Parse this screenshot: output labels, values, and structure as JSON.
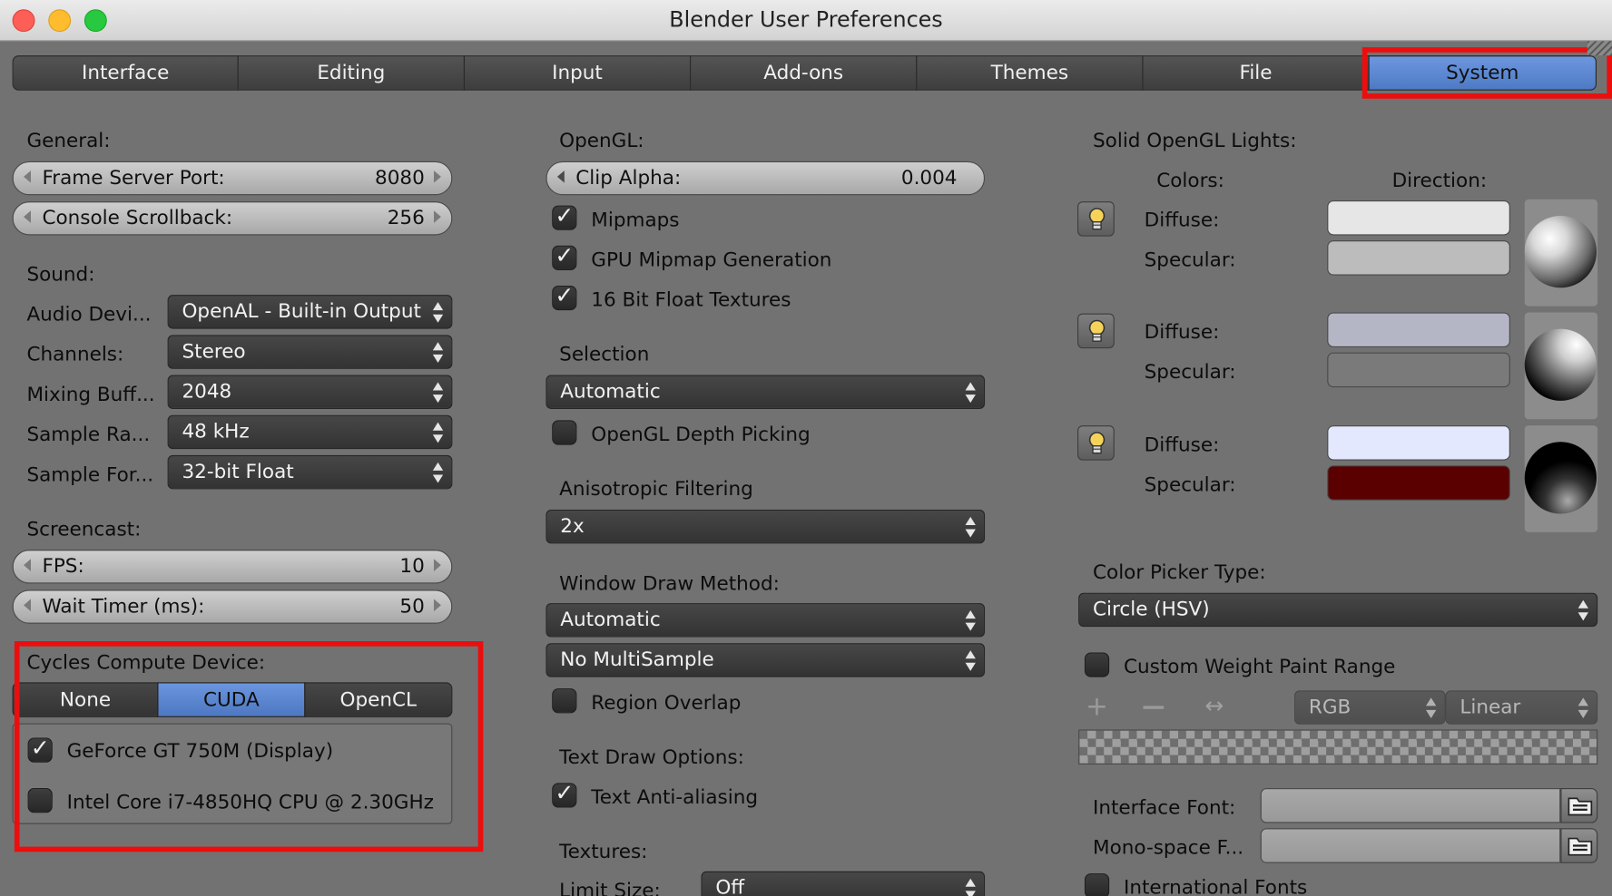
{
  "window": {
    "title": "Blender User Preferences"
  },
  "tabs": [
    "Interface",
    "Editing",
    "Input",
    "Add-ons",
    "Themes",
    "File",
    "System"
  ],
  "colors": {
    "accent": "#5b86d1",
    "highlight_box": "#ec0e0e",
    "panel_bg": "#727272"
  },
  "general": {
    "heading": "General:",
    "frame_server_port": {
      "label": "Frame Server Port:",
      "value": "8080"
    },
    "console_scrollback": {
      "label": "Console Scrollback:",
      "value": "256"
    }
  },
  "sound": {
    "heading": "Sound:",
    "audio_device": {
      "label": "Audio Devi...",
      "value": "OpenAL - Built-in Output"
    },
    "channels": {
      "label": "Channels:",
      "value": "Stereo"
    },
    "mixing_buffer": {
      "label": "Mixing Buff...",
      "value": "2048"
    },
    "sample_rate": {
      "label": "Sample Ra...",
      "value": "48 kHz"
    },
    "sample_format": {
      "label": "Sample For...",
      "value": "32-bit Float"
    }
  },
  "screencast": {
    "heading": "Screencast:",
    "fps": {
      "label": "FPS:",
      "value": "10"
    },
    "wait_timer": {
      "label": "Wait Timer (ms):",
      "value": "50"
    }
  },
  "cycles": {
    "heading": "Cycles Compute Device:",
    "options": [
      "None",
      "CUDA",
      "OpenCL"
    ],
    "selected": "CUDA",
    "devices": [
      {
        "label": "GeForce GT 750M (Display)",
        "checked": true
      },
      {
        "label": "Intel Core i7-4850HQ CPU @ 2.30GHz",
        "checked": false
      }
    ]
  },
  "opengl": {
    "heading": "OpenGL:",
    "clip_alpha": {
      "label": "Clip Alpha:",
      "value": "0.004"
    },
    "mipmaps": {
      "label": "Mipmaps",
      "checked": true
    },
    "gpu_mipmap": {
      "label": "GPU Mipmap Generation",
      "checked": true
    },
    "float_textures": {
      "label": "16 Bit Float Textures",
      "checked": true
    }
  },
  "selection": {
    "heading": "Selection",
    "value": "Automatic",
    "depth_picking": {
      "label": "OpenGL Depth Picking",
      "checked": false
    }
  },
  "anisotropic": {
    "heading": "Anisotropic Filtering",
    "value": "2x"
  },
  "window_draw": {
    "heading": "Window Draw Method:",
    "method": "Automatic",
    "multisample": "No MultiSample",
    "region_overlap": {
      "label": "Region Overlap",
      "checked": false
    }
  },
  "text_draw": {
    "heading": "Text Draw Options:",
    "anti_aliasing": {
      "label": "Text Anti-aliasing",
      "checked": true
    }
  },
  "textures": {
    "heading": "Textures:",
    "limit_size": {
      "label": "Limit Size:",
      "value": "Off"
    }
  },
  "lights": {
    "heading": "Solid OpenGL Lights:",
    "colors_heading": "Colors:",
    "direction_heading": "Direction:",
    "diffuse_label": "Diffuse:",
    "specular_label": "Specular:",
    "items": [
      {
        "diffuse": "#e6e6e6",
        "specular": "#bcbcbc"
      },
      {
        "diffuse": "#b4b6c6",
        "specular": "#7a7a7a"
      },
      {
        "diffuse": "#e4e8fe",
        "specular": "#5a0000"
      }
    ]
  },
  "color_picker": {
    "heading": "Color Picker Type:",
    "value": "Circle (HSV)"
  },
  "weight_paint": {
    "label": "Custom Weight Paint Range",
    "checked": false,
    "color_mode": "RGB",
    "interpolation": "Linear"
  },
  "fonts": {
    "interface_font": {
      "label": "Interface Font:",
      "value": ""
    },
    "mono_font": {
      "label": "Mono-space F...",
      "value": ""
    },
    "international": {
      "label": "International Fonts",
      "checked": false
    }
  }
}
